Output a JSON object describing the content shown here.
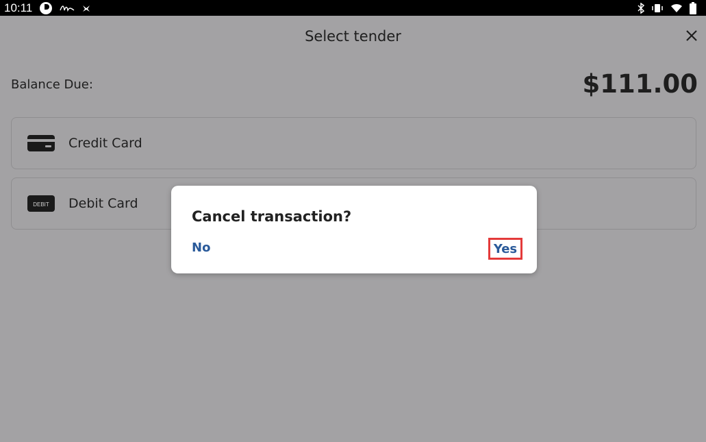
{
  "status_bar": {
    "time": "10:11"
  },
  "header": {
    "title": "Select tender"
  },
  "balance": {
    "label": "Balance Due:",
    "amount": "$111.00"
  },
  "tenders": [
    {
      "label": "Credit Card",
      "icon": "credit-card-icon"
    },
    {
      "label": "Debit Card",
      "icon": "debit-card-icon",
      "icon_text": "DEBIT"
    }
  ],
  "dialog": {
    "title": "Cancel transaction?",
    "no_label": "No",
    "yes_label": "Yes"
  },
  "colors": {
    "overlay_background": "#a3a2a4",
    "link": "#2a5a9a",
    "highlight": "#e43a3a"
  }
}
